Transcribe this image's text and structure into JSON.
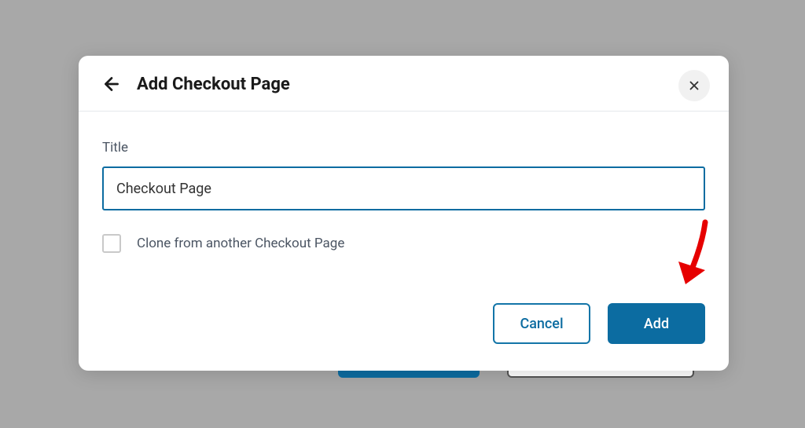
{
  "header": {
    "title": "Add Checkout Page"
  },
  "form": {
    "title_label": "Title",
    "title_value": "Checkout Page",
    "clone_label": "Clone from another Checkout Page"
  },
  "actions": {
    "cancel": "Cancel",
    "add": "Add"
  }
}
